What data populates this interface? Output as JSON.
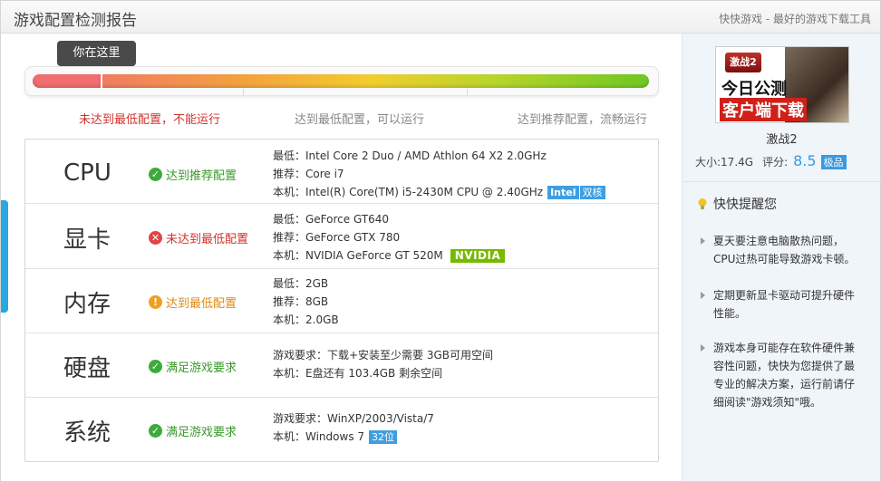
{
  "header": {
    "title": "游戏配置检测报告",
    "right_text": "快快游戏 - 最好的游戏下载工具"
  },
  "progress": {
    "bubble_label": "你在这里",
    "level_fraction": 0.11,
    "levels": [
      {
        "label": "未达到最低配置，不能运行",
        "state": "fail"
      },
      {
        "label": "达到最低配置，可以运行",
        "state": "normal"
      },
      {
        "label": "达到推荐配置，流畅运行",
        "state": "normal"
      }
    ]
  },
  "specs": [
    {
      "category": "CPU",
      "status": {
        "label": "达到推荐配置",
        "type": "ok",
        "icon": "check-icon"
      },
      "lines": [
        {
          "label": "最低：Intel Core 2 Duo / AMD Athlon 64 X2 2.0GHz"
        },
        {
          "label": "推荐：Core i7"
        },
        {
          "label": "本机：Intel(R) Core(TM) i5-2430M CPU @ 2.40GHz",
          "badges": [
            "Intel",
            "双核"
          ]
        }
      ]
    },
    {
      "category": "显卡",
      "status": {
        "label": "未达到最低配置",
        "type": "bad",
        "icon": "cross-icon"
      },
      "lines": [
        {
          "label": "最低：GeForce GT640"
        },
        {
          "label": "推荐：GeForce GTX 780"
        },
        {
          "label": "本机：NVIDIA GeForce GT 520M",
          "badges": [
            "NVIDIA"
          ]
        }
      ]
    },
    {
      "category": "内存",
      "status": {
        "label": "达到最低配置",
        "type": "warn",
        "icon": "warning-icon"
      },
      "lines": [
        {
          "label": "最低：2GB"
        },
        {
          "label": "推荐：8GB"
        },
        {
          "label": "本机：2.0GB"
        }
      ]
    },
    {
      "category": "硬盘",
      "status": {
        "label": "满足游戏要求",
        "type": "ok",
        "icon": "check-icon"
      },
      "lines": [
        {
          "label": "游戏要求：下载+安装至少需要 3GB可用空间"
        },
        {
          "label": "本机：E盘还有 103.4GB 剩余空间"
        }
      ]
    },
    {
      "category": "系统",
      "status": {
        "label": "满足游戏要求",
        "type": "ok",
        "icon": "check-icon"
      },
      "lines": [
        {
          "label": "游戏要求：WinXP/2003/Vista/7"
        },
        {
          "label": "本机：Windows 7",
          "badges": [
            "32位"
          ]
        }
      ]
    }
  ],
  "game": {
    "ad": {
      "logo_text": "激战2",
      "line1": "今日公测",
      "line2": "客户端下载"
    },
    "name": "激战2",
    "size": "大小:17.4G",
    "rating_label": "评分:",
    "rating_value": "8.5",
    "rating_badge": "极品"
  },
  "tips": {
    "title": "快快提醒您",
    "items": [
      {
        "text": "夏天要注意电脑散热问题，CPU过热可能导致游戏卡顿。"
      },
      {
        "text": "定期更新显卡驱动可提升硬件性能。"
      },
      {
        "text": "游戏本身可能存在软件硬件兼容性问题，快快为您提供了最专业的解决方案，运行前请仔细阅读\"游戏须知\"哦。"
      }
    ]
  },
  "colors": {
    "accent_blue": "#3a9ae0",
    "ok_green": "#3cab3b",
    "fail_red": "#e04444",
    "warn_orange": "#f0a020",
    "nvidia_green": "#76b900"
  }
}
